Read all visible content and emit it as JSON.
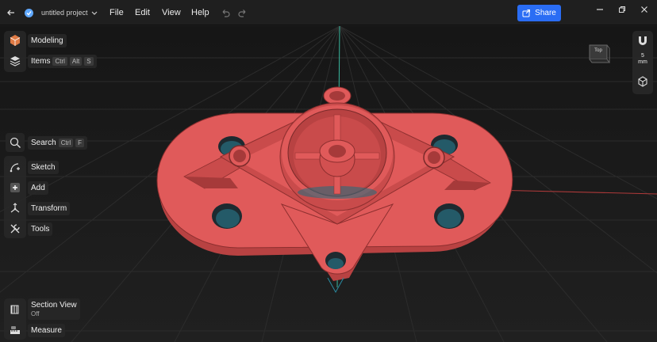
{
  "titlebar": {
    "project_name": "untitled project",
    "menu": [
      "File",
      "Edit",
      "View",
      "Help"
    ],
    "share_label": "Share"
  },
  "tools": {
    "modeling": "Modeling",
    "items": "Items",
    "items_shortcut": [
      "Ctrl",
      "Alt",
      "S"
    ],
    "search": "Search",
    "search_shortcut": [
      "Ctrl",
      "F"
    ],
    "sketch": "Sketch",
    "add": "Add",
    "transform": "Transform",
    "tools": "Tools",
    "section_view": "Section View",
    "section_view_state": "Off",
    "measure": "Measure"
  },
  "viewcube": {
    "face": "Top"
  },
  "grid": {
    "size_value": "5",
    "size_unit": "mm"
  },
  "colors": {
    "part": "#e05a5a",
    "part_dark": "#b84242",
    "accent": "#2a6df4",
    "grid": "#2c2c2c"
  }
}
